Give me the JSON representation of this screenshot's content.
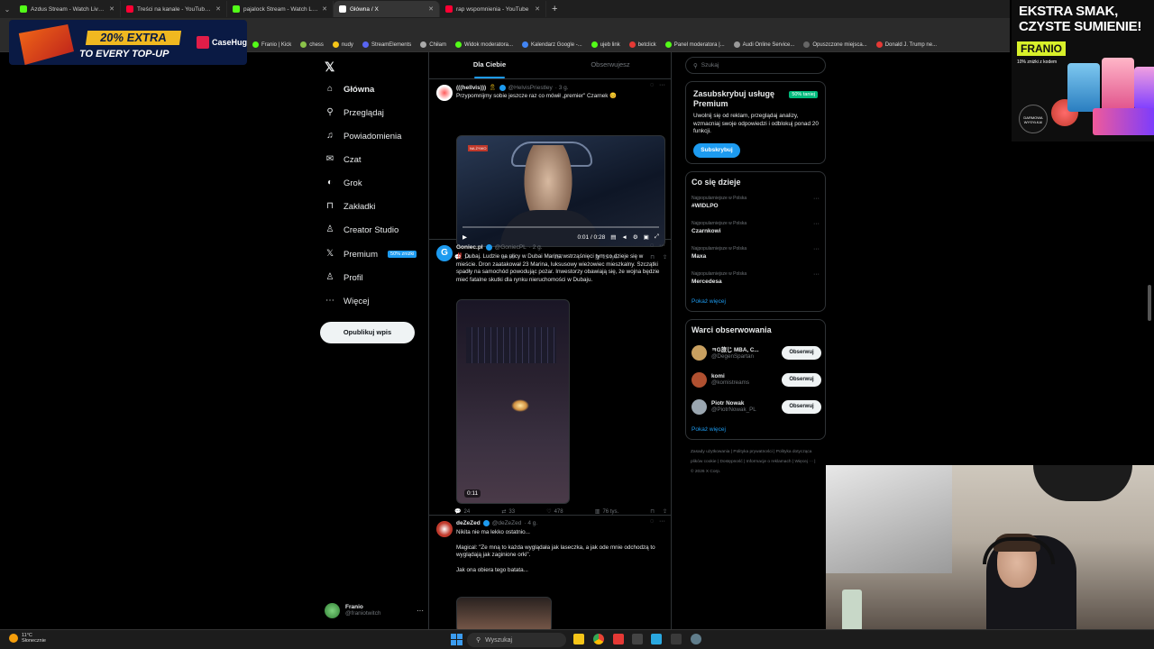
{
  "browser": {
    "tabs": [
      {
        "label": "Azdus Stream - Watch Live on Kick",
        "color": "#53fc18",
        "active": false
      },
      {
        "label": "Treści na kanale - YouTube Studio",
        "color": "#ff0033",
        "active": false
      },
      {
        "label": "pajalock Stream - Watch Live on Kick",
        "color": "#53fc18",
        "active": false
      },
      {
        "label": "Główna / X",
        "color": "#ffffff",
        "active": true
      },
      {
        "label": "rap wspomnienia - YouTube",
        "color": "#ff0033",
        "active": false
      }
    ],
    "bookmarks": [
      {
        "label": "Franio | Kick",
        "color": "#53fc18"
      },
      {
        "label": "chess",
        "color": "#8bc34a"
      },
      {
        "label": "nudy",
        "color": "#f5c518"
      },
      {
        "label": "StreamElements",
        "color": "#5865f2"
      },
      {
        "label": "Chiłam",
        "color": "#aaaaaa"
      },
      {
        "label": "Widok moderatora...",
        "color": "#53fc18"
      },
      {
        "label": "Kalendarz Google -...",
        "color": "#4285f4"
      },
      {
        "label": "ujeb link",
        "color": "#53fc18"
      },
      {
        "label": "betclick",
        "color": "#e53935"
      },
      {
        "label": "Panel moderatora |...",
        "color": "#53fc18"
      },
      {
        "label": "Audi Online Service...",
        "color": "#999999"
      },
      {
        "label": "Opuszczone miejsca...",
        "color": "#666666"
      },
      {
        "label": "Donald J. Trump ne...",
        "color": "#e53935"
      }
    ]
  },
  "promo": {
    "badge": "20% EXTRA",
    "sub": "TO EVERY TOP-UP",
    "brand": "CaseHug"
  },
  "ad": {
    "headline": "EKSTRA SMAK, CZYSTE SUMIENIE!",
    "brand": "FRANIO",
    "promo": "10% zniżki z kodem",
    "circle": "DARMOWA WYSYŁKA!"
  },
  "nav": {
    "logo": "𝕏",
    "items": [
      {
        "label": "Główna",
        "icon": "⌂",
        "name": "home"
      },
      {
        "label": "Przeglądaj",
        "icon": "⚲",
        "name": "explore"
      },
      {
        "label": "Powiadomienia",
        "icon": "♫",
        "name": "notifications"
      },
      {
        "label": "Czat",
        "icon": "✉",
        "name": "chat"
      },
      {
        "label": "Grok",
        "icon": "◐",
        "name": "grok"
      },
      {
        "label": "Zakładki",
        "icon": "⊓",
        "name": "bookmarks"
      },
      {
        "label": "Creator Studio",
        "icon": "♙",
        "name": "creator-studio"
      },
      {
        "label": "Premium",
        "icon": "𝕏",
        "name": "premium"
      },
      {
        "label": "Profil",
        "icon": "♙",
        "name": "profile"
      },
      {
        "label": "Więcej",
        "icon": "⋯",
        "name": "more"
      }
    ],
    "premium_badge": "50% zniżki",
    "post_button": "Opublikuj wpis",
    "account": {
      "name": "Franio",
      "handle": "@franiotwitch"
    }
  },
  "feed": {
    "tabs": [
      "Dla Ciebie",
      "Obserwujesz"
    ],
    "tweets": [
      {
        "name": "(((hellvis)))",
        "handle": "@HelvisPriestley",
        "time": "· 3 g.",
        "text": "Przypomnijmy sobie jeszcze raz co mówił „premier\" Czarnek 😊",
        "video_time": "0:01 / 0:28",
        "live_tag": "NA ŻYWO",
        "stats": {
          "replies": "14",
          "reposts": "59",
          "likes": "257",
          "views": "25 tys."
        }
      },
      {
        "name": "Goniec.pl",
        "handle": "@GoniecPL",
        "time": "· 2 g.",
        "text": "‼️ Dubaj. Ludzie na ulicy w Dubai Marina wstrząśnięci tym co dzieje się w mieście. Dron zaatakował 23 Marina, luksusowy wieżowiec mieszkalny. Szczątki spadły na samochód powodując pożar. Inwestorzy obawiają się, że wojna będzie mieć fatalne skutki dla rynku nieruchomości w Dubaju.",
        "video_time": "0:11",
        "stats": {
          "replies": "24",
          "reposts": "33",
          "likes": "478",
          "views": "76 tys."
        }
      },
      {
        "name": "deZeZed",
        "handle": "@deZeZed",
        "time": "· 4 g.",
        "text1": "Nikita nie ma lekko ostatnio...",
        "text2": "Magical: \"Ze mną to każda wyglądała jak laseczka, a jak ode mnie odchodzą to wyglądają jak zaginione orki\".",
        "text3": "Jak ona obiera tego batata..."
      }
    ]
  },
  "sidebar": {
    "search_placeholder": "Szukaj",
    "premium": {
      "title": "Zasubskrybuj usługę Premium",
      "tag": "50% taniej",
      "text": "Uwolnij się od reklam, przeglądaj analizy, wzmacniaj swoje odpowiedzi i odblokuj ponad 20 funkcji.",
      "button": "Subskrybuj"
    },
    "trends": {
      "title": "Co się dzieje",
      "items": [
        {
          "meta": "Najpopularniejsze w Polska",
          "value": "#WIDLPO"
        },
        {
          "meta": "Najpopularniejsze w Polska",
          "value": "Czarnkowi"
        },
        {
          "meta": "Najpopularniejsze w Polska",
          "value": "Maxa"
        },
        {
          "meta": "Najpopularniejsze w Polska",
          "value": "Mercedesa"
        }
      ],
      "more": "Pokaż więcej"
    },
    "follow": {
      "title": "Warci obserwowania",
      "items": [
        {
          "name": "ㅋG旅じ MBA, C...",
          "handle": "@DegenSpartan",
          "color": "#c9a060"
        },
        {
          "name": "komi",
          "handle": "@komistreams",
          "color": "#b05030"
        },
        {
          "name": "Piotr Nowak",
          "handle": "@PiotrNowak_PL",
          "color": "#9aa6b0"
        }
      ],
      "button": "Obserwuj",
      "more": "Pokaż więcej"
    },
    "footer": "Zasady użytkowania | Polityka prywatności | Polityka dotycząca plików cookie | Dostępność | Informacje o reklamach | Więcej ··· | © 2026 X Corp."
  },
  "taskbar": {
    "temp": "11°C",
    "weather": "Słonecznie",
    "search": "Wyszukaj"
  }
}
